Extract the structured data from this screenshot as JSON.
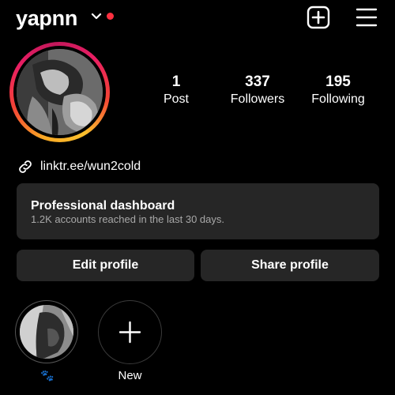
{
  "header": {
    "username": "yapnn",
    "notification_color": "#ff3040",
    "icons": [
      "chevron-down-icon",
      "create-icon",
      "menu-icon"
    ]
  },
  "profile": {
    "avatar_icon": "profile-photo",
    "story_ring_colors": [
      "#f9a825",
      "#f44336",
      "#e91e63",
      "#c2185b"
    ],
    "stats": [
      {
        "value": "1",
        "label": "Post"
      },
      {
        "value": "337",
        "label": "Followers"
      },
      {
        "value": "195",
        "label": "Following"
      }
    ],
    "link_icon": "link-icon",
    "link_text": "linktr.ee/wun2cold"
  },
  "dashboard": {
    "title": "Professional dashboard",
    "subtitle": "1.2K accounts reached in the last 30 days."
  },
  "actions": {
    "edit_label": "Edit profile",
    "share_label": "Share profile"
  },
  "highlights": [
    {
      "label": "🐾",
      "icon": "highlight-photo"
    },
    {
      "label": "New",
      "icon": "plus-icon"
    }
  ]
}
